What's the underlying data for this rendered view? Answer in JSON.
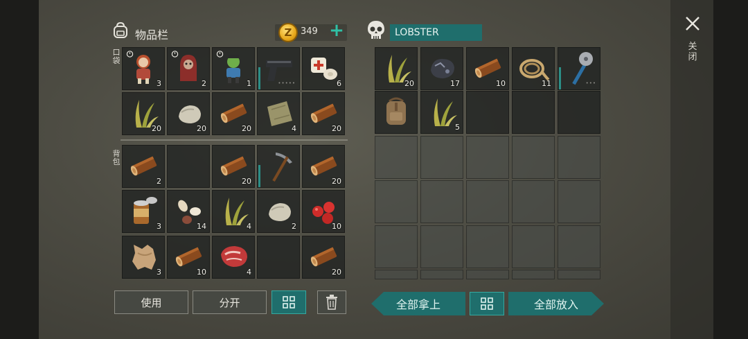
{
  "inventory": {
    "title": "物品栏",
    "coins": "349",
    "coin_symbol": "Z",
    "pocket_label": "口袋",
    "backpack_label": "背包",
    "slots": [
      {
        "icon": "zombie-doll-red-hair-icon",
        "count": "3",
        "timer": true
      },
      {
        "icon": "zombie-doll-hooded-icon",
        "count": "2",
        "timer": true
      },
      {
        "icon": "zombie-doll-green-icon",
        "count": "1",
        "timer": true
      },
      {
        "icon": "pistol-icon",
        "count": "",
        "dots": "•••••",
        "durability": true
      },
      {
        "icon": "bandage-icon",
        "count": "6"
      },
      {
        "icon": "plant-fiber-icon",
        "count": "20"
      },
      {
        "icon": "stone-icon",
        "count": "20"
      },
      {
        "icon": "wood-log-icon",
        "count": "20"
      },
      {
        "icon": "cloth-scrap-icon",
        "count": "4"
      },
      {
        "icon": "wood-log-icon",
        "count": "20"
      },
      {
        "icon": "wood-log-icon",
        "count": "2"
      },
      {
        "icon": "",
        "count": ""
      },
      {
        "icon": "wood-log-icon",
        "count": "20"
      },
      {
        "icon": "pickaxe-icon",
        "count": "",
        "durability": true
      },
      {
        "icon": "wood-log-icon",
        "count": "20"
      },
      {
        "icon": "canned-food-icon",
        "count": "3"
      },
      {
        "icon": "seeds-icon",
        "count": "14"
      },
      {
        "icon": "plant-fiber-icon",
        "count": "4"
      },
      {
        "icon": "stone-icon",
        "count": "2"
      },
      {
        "icon": "berries-icon",
        "count": "10"
      },
      {
        "icon": "animal-hide-icon",
        "count": "3"
      },
      {
        "icon": "wood-log-icon",
        "count": "10"
      },
      {
        "icon": "raw-meat-icon",
        "count": "4"
      },
      {
        "icon": "",
        "count": ""
      },
      {
        "icon": "wood-log-icon",
        "count": "20"
      }
    ],
    "use_label": "使用",
    "split_label": "分开"
  },
  "container": {
    "name": "LOBSTER",
    "slots": [
      {
        "icon": "plant-fiber-icon",
        "count": "20"
      },
      {
        "icon": "iron-ore-icon",
        "count": "17"
      },
      {
        "icon": "wood-log-icon",
        "count": "10"
      },
      {
        "icon": "rope-icon",
        "count": "11"
      },
      {
        "icon": "saw-blade-club-icon",
        "count": "",
        "dots": "•••",
        "durability": true
      },
      {
        "icon": "backpack-icon",
        "count": ""
      },
      {
        "icon": "plant-fiber-icon",
        "count": "5"
      }
    ],
    "take_all_label": "全部拿上",
    "put_all_label": "全部放入"
  },
  "close_label": "关闭",
  "colors": {
    "accent_teal": "#1f6e6c",
    "plus_green": "#2fc1a6",
    "gold": "#e7a81b"
  }
}
